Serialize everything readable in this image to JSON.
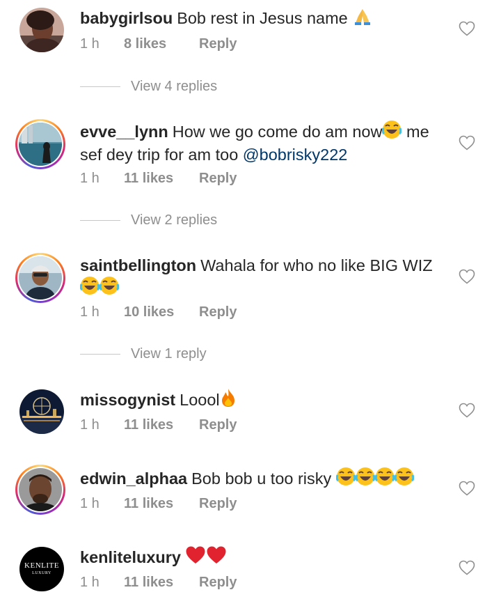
{
  "comments": [
    {
      "username": "babygirlsou",
      "text": "Bob rest in Jesus name",
      "emoji": [
        "pray"
      ],
      "time": "1 h",
      "likes": "8 likes",
      "reply": "Reply",
      "view_replies": "View 4 replies"
    },
    {
      "username": "evve__lynn",
      "text_before": "How we go come do am now",
      "emoji": [
        "joy"
      ],
      "text_after": " me sef dey trip for am too ",
      "mention": "@bobrisky222",
      "time": "1 h",
      "likes": "11 likes",
      "reply": "Reply",
      "view_replies": "View 2 replies"
    },
    {
      "username": "saintbellington",
      "text": "Wahala for who no like BIG WIZ",
      "emoji": [
        "joy",
        "joy"
      ],
      "time": "1 h",
      "likes": "10 likes",
      "reply": "Reply",
      "view_replies": "View 1 reply"
    },
    {
      "username": "missogynist",
      "text": "Loool",
      "emoji": [
        "fire"
      ],
      "time": "1 h",
      "likes": "11 likes",
      "reply": "Reply"
    },
    {
      "username": "edwin_alphaa",
      "text": "Bob bob u too risky",
      "emoji": [
        "joy",
        "joy",
        "joy",
        "joy"
      ],
      "time": "1 h",
      "likes": "11 likes",
      "reply": "Reply"
    },
    {
      "username": "kenliteluxury",
      "text": "",
      "emoji": [
        "heart",
        "heart"
      ],
      "time": "1 h",
      "likes": "11 likes",
      "reply": "Reply",
      "avatar_logo": "KENLITE",
      "avatar_logo_sub": "LUXURY"
    }
  ],
  "colors": {
    "text": "#262626",
    "meta": "#8e8e8e",
    "mention": "#00376b",
    "divider": "#c7c7c7"
  },
  "icons": {
    "like": "heart-outline-icon"
  }
}
